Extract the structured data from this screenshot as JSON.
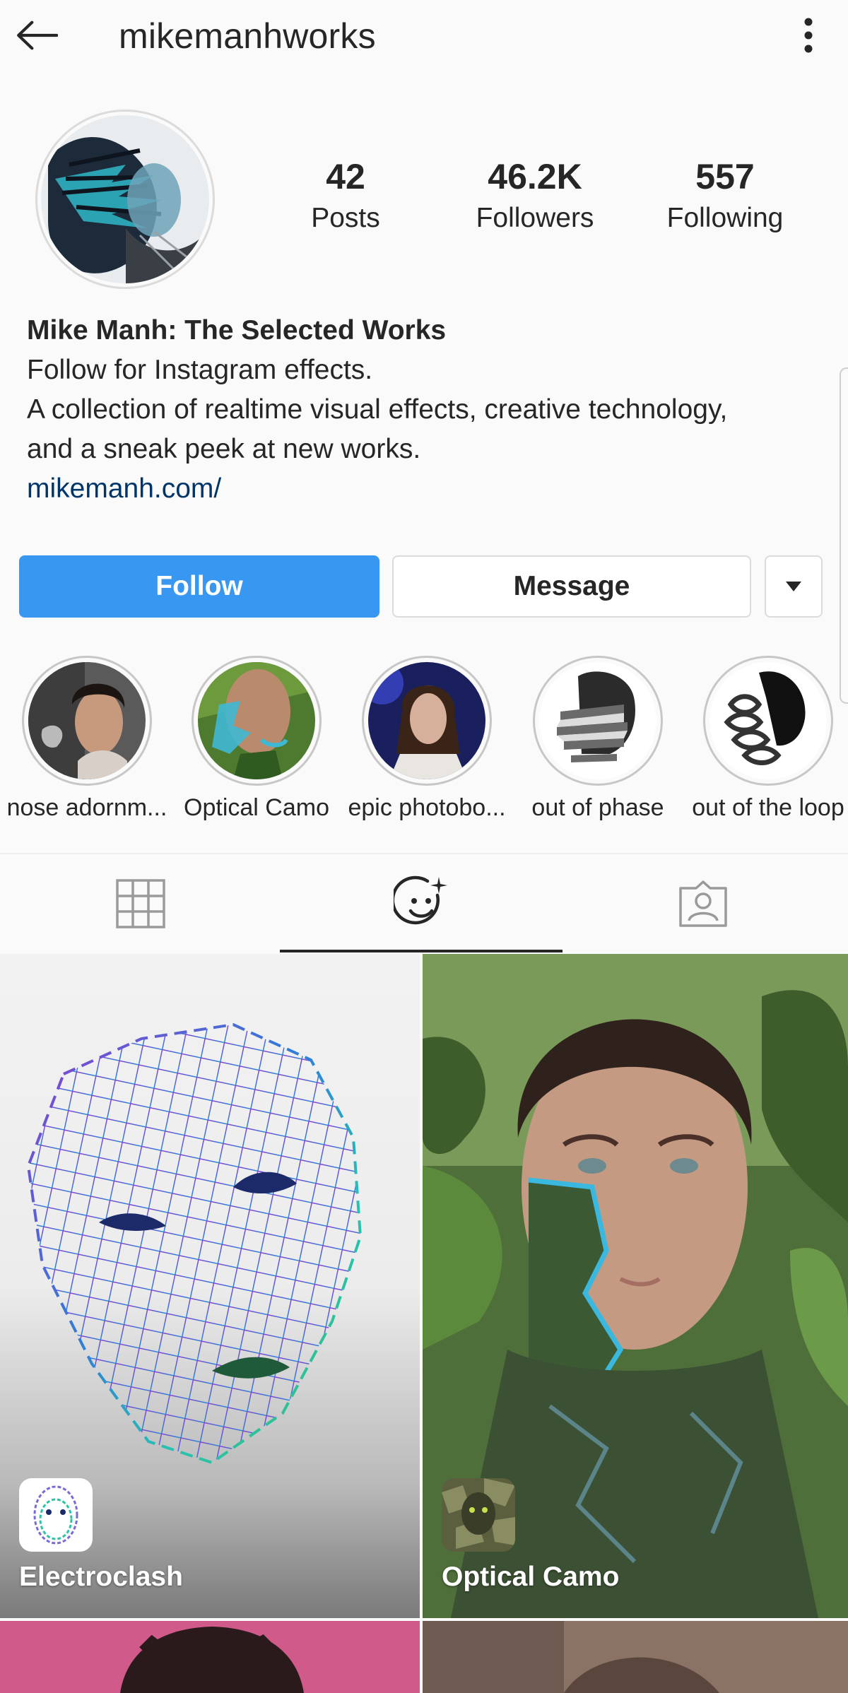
{
  "header": {
    "username": "mikemanhworks",
    "back_icon": "arrow-left-icon",
    "more_icon": "vertical-dots-icon"
  },
  "stats": {
    "posts": {
      "value": "42",
      "label": "Posts"
    },
    "followers": {
      "value": "46.2K",
      "label": "Followers"
    },
    "following": {
      "value": "557",
      "label": "Following"
    }
  },
  "bio": {
    "name": "Mike Manh: The Selected Works",
    "line1": "Follow for Instagram effects.",
    "line2": "A collection of realtime visual effects, creative technology,",
    "line3": "and a sneak peek at new works.",
    "link": "mikemanh.com/"
  },
  "actions": {
    "follow_label": "Follow",
    "message_label": "Message",
    "dropdown_icon": "caret-down-icon"
  },
  "highlights": [
    {
      "label": "nose adornm..."
    },
    {
      "label": "Optical Camo"
    },
    {
      "label": "epic photobo..."
    },
    {
      "label": "out of phase"
    },
    {
      "label": "out of the loop"
    }
  ],
  "tabs": {
    "grid_icon": "grid-icon",
    "effects_icon": "face-effects-icon",
    "tagged_icon": "tagged-person-icon",
    "active": "effects"
  },
  "effects": [
    {
      "title": "Electroclash"
    },
    {
      "title": "Optical Camo"
    }
  ],
  "colors": {
    "follow_blue": "#3897f0",
    "link_navy": "#003569",
    "text": "#262626",
    "background": "#fafafa"
  }
}
